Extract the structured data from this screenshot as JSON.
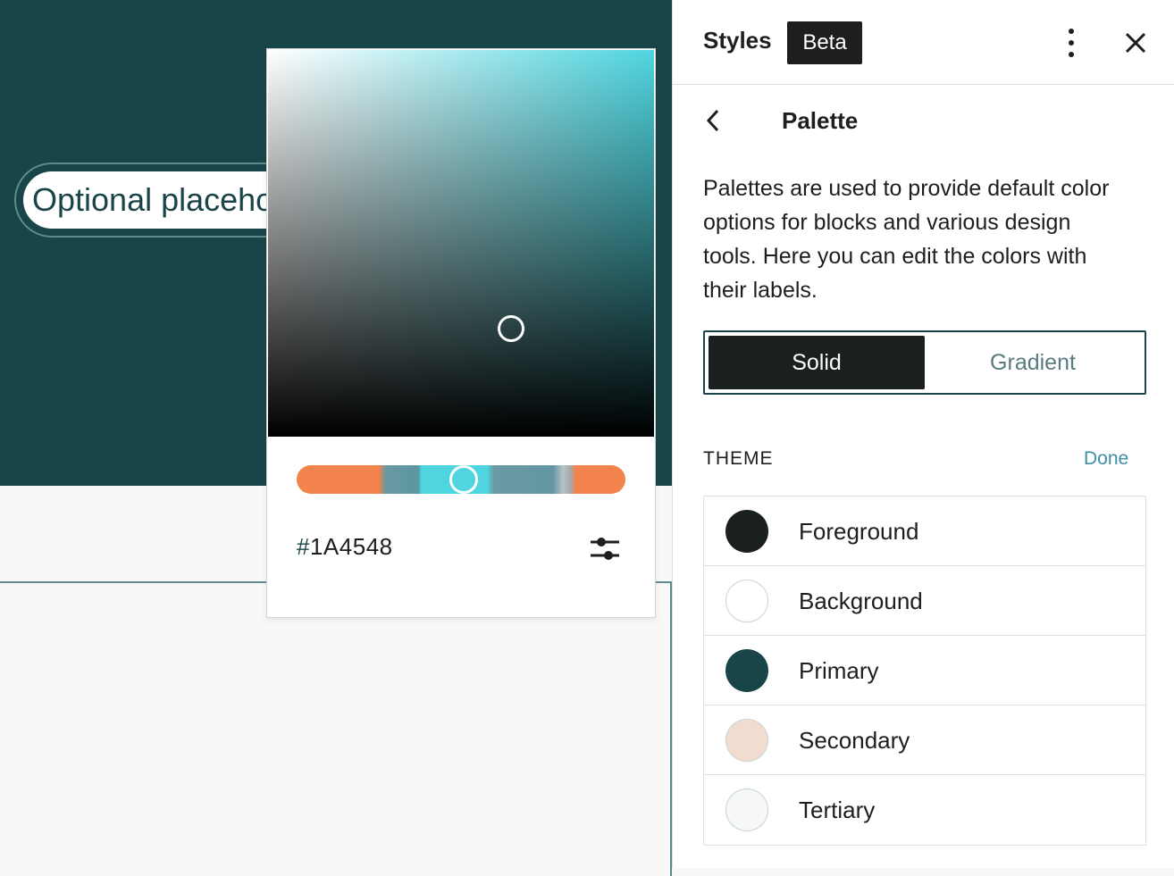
{
  "canvas": {
    "search_placeholder": "Optional placeholder",
    "hero_color": "#1a4548"
  },
  "color_picker": {
    "hex_hash": "#",
    "hex_value": "1A4548",
    "settings_icon": "sliders-icon"
  },
  "sidebar": {
    "title": "Styles",
    "badge": "Beta",
    "more_icon": "vertical-ellipsis-icon",
    "close_icon": "close-icon",
    "back_icon": "chevron-left-icon",
    "panel_title": "Palette",
    "description": "Palettes are used to provide default color options for blocks and various design tools. Here you can edit the colors with their labels.",
    "tabs": [
      {
        "label": "Solid",
        "selected": true
      },
      {
        "label": "Gradient",
        "selected": false
      }
    ],
    "section_label": "THEME",
    "done_label": "Done",
    "colors": [
      {
        "name": "Foreground",
        "color": "#1a1f1f"
      },
      {
        "name": "Background",
        "color": "#ffffff"
      },
      {
        "name": "Primary",
        "color": "#1a4548"
      },
      {
        "name": "Secondary",
        "color": "#f2dccf"
      },
      {
        "name": "Tertiary",
        "color": "#f6f8f8"
      }
    ]
  }
}
